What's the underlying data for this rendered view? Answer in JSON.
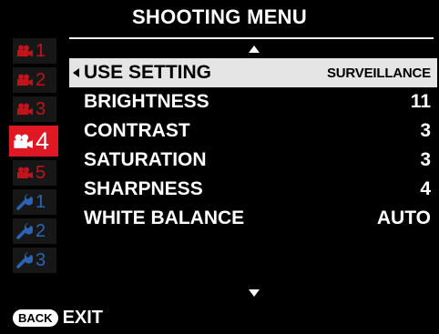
{
  "header": {
    "title": "SHOOTING MENU"
  },
  "tabs": [
    {
      "icon": "movie-camera-icon",
      "label": "1",
      "color": "#c0141c",
      "active": false
    },
    {
      "icon": "movie-camera-icon",
      "label": "2",
      "color": "#c0141c",
      "active": false
    },
    {
      "icon": "movie-camera-icon",
      "label": "3",
      "color": "#c0141c",
      "active": false
    },
    {
      "icon": "movie-camera-icon",
      "label": "4",
      "color": "#e01823",
      "active": true
    },
    {
      "icon": "movie-camera-icon",
      "label": "5",
      "color": "#c0141c",
      "active": false
    },
    {
      "icon": "wrench-icon",
      "label": "1",
      "color": "#2c63b5",
      "active": false
    },
    {
      "icon": "wrench-icon",
      "label": "2",
      "color": "#2c63b5",
      "active": false
    },
    {
      "icon": "wrench-icon",
      "label": "3",
      "color": "#2c63b5",
      "active": false
    }
  ],
  "menu": {
    "items": [
      {
        "label": "USE SETTING",
        "value": "SURVEILLANCE",
        "selected": true
      },
      {
        "label": "BRIGHTNESS",
        "value": "11"
      },
      {
        "label": "CONTRAST",
        "value": "3"
      },
      {
        "label": "SATURATION",
        "value": "3"
      },
      {
        "label": "SHARPNESS",
        "value": "4"
      },
      {
        "label": "WHITE BALANCE",
        "value": "AUTO"
      }
    ]
  },
  "footer": {
    "back_label": "BACK",
    "exit_label": "EXIT"
  }
}
